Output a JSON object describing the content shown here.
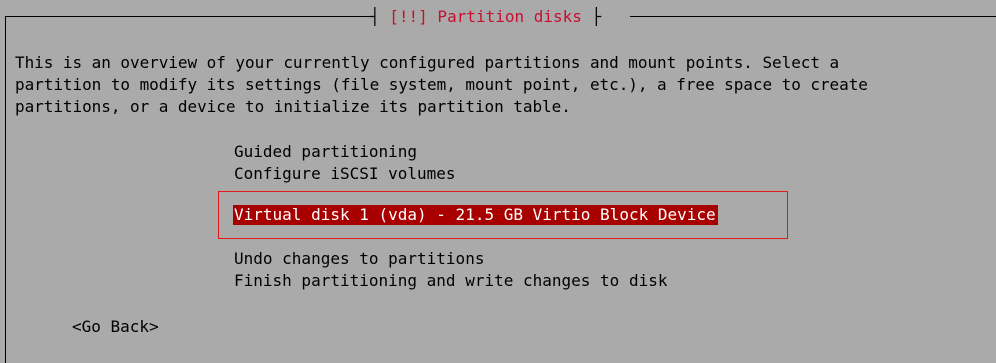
{
  "dialog": {
    "title": "[!!] Partition disks",
    "title_left_sep": "┤ ",
    "title_right_sep": " ├",
    "description_lines": [
      "This is an overview of your currently configured partitions and mount points. Select a",
      "partition to modify its settings (file system, mount point, etc.), a free space to create",
      "partitions, or a device to initialize its partition table."
    ]
  },
  "menu": {
    "items_top": [
      "Guided partitioning",
      "Configure iSCSI volumes"
    ],
    "selected_item": "Virtual disk 1 (vda) - 21.5 GB Virtio Block Device",
    "items_bottom": [
      "Undo changes to partitions",
      "Finish partitioning and write changes to disk"
    ]
  },
  "buttons": {
    "go_back": "<Go Back>"
  },
  "colors": {
    "dialog_background": "#aaaaaa",
    "title_text": "#c8102e",
    "selection_background": "#a80000",
    "selection_text": "#ffffff",
    "highlight_outline": "#e11a1a"
  }
}
